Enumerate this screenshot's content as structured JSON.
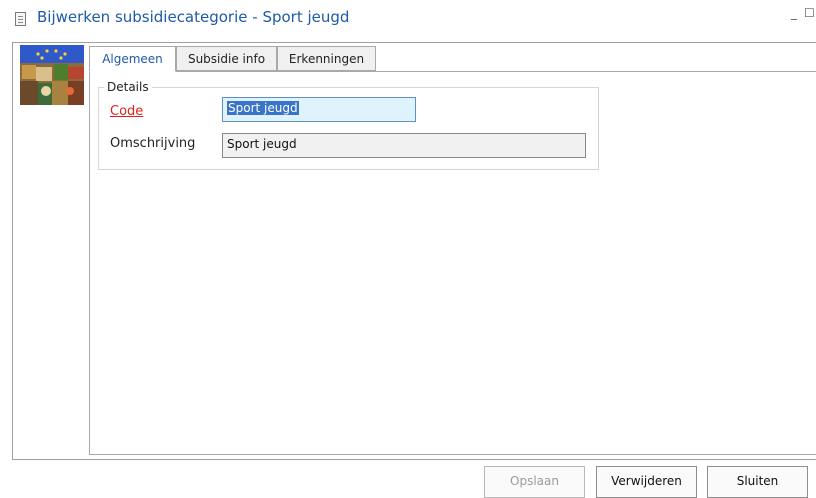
{
  "window": {
    "title": "Bijwerken subsidiecategorie - Sport jeugd",
    "minimize": "_",
    "maximize": "☐",
    "close": "×"
  },
  "tabs": [
    {
      "label": "Algemeen",
      "active": true
    },
    {
      "label": "Subsidie info",
      "active": false
    },
    {
      "label": "Erkenningen",
      "active": false
    }
  ],
  "details": {
    "legend": "Details",
    "code_label": "Code",
    "code_value": "Sport jeugd",
    "omschrijving_label": "Omschrijving",
    "omschrijving_value": "Sport jeugd"
  },
  "buttons": {
    "save": "Opslaan",
    "delete": "Verwijderen",
    "close": "Sluiten"
  },
  "colors": {
    "title": "#1f5aa8",
    "required_label": "#e02020",
    "selection": "#3a74c8"
  }
}
